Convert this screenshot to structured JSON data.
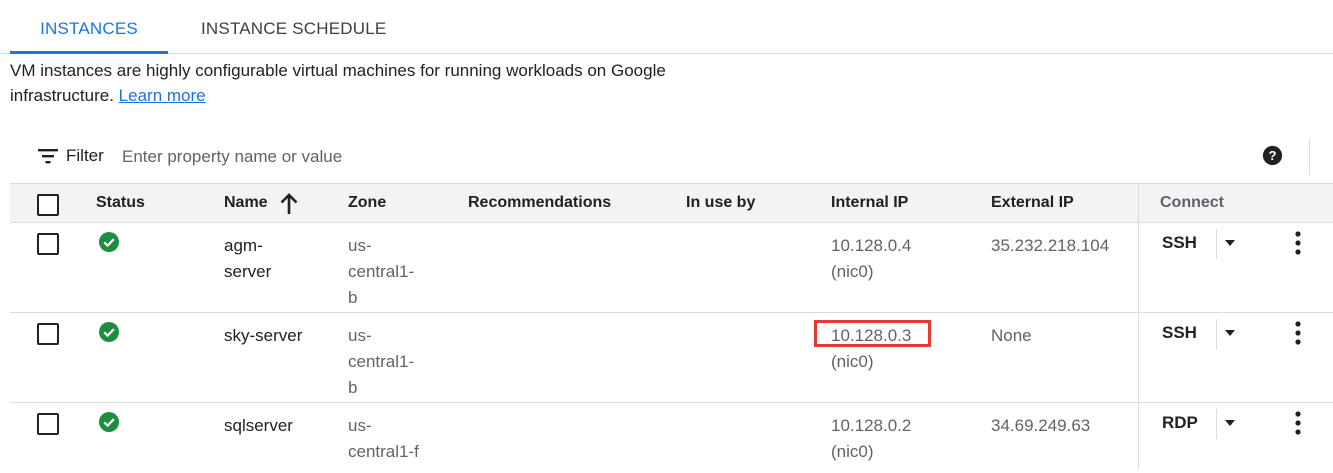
{
  "tabs": [
    {
      "label": "INSTANCES",
      "active": true
    },
    {
      "label": "INSTANCE SCHEDULE",
      "active": false
    }
  ],
  "description": {
    "text": "VM instances are highly configurable virtual machines for running workloads on Google infrastructure.",
    "link": "Learn more"
  },
  "filter": {
    "label": "Filter",
    "placeholder": "Enter property name or value",
    "icon": "filter-list-icon",
    "help_icon": "help-icon"
  },
  "columns": {
    "status": "Status",
    "name": "Name",
    "zone": "Zone",
    "recommendations": "Recommendations",
    "in_use_by": "In use by",
    "internal_ip": "Internal IP",
    "external_ip": "External IP",
    "connect": "Connect"
  },
  "rows": [
    {
      "status": "running",
      "name_l1": "agm-",
      "name_l2": "server",
      "zone_l1": "us-",
      "zone_l2": "central1-",
      "zone_l3": "b",
      "internal_ip": "10.128.0.4",
      "nic": "(nic0)",
      "external_ip": "35.232.218.104",
      "connect": "SSH"
    },
    {
      "status": "running",
      "name_l1": "sky-server",
      "zone_l1": "us-",
      "zone_l2": "central1-",
      "zone_l3": "b",
      "internal_ip": "10.128.0.3",
      "nic": "(nic0)",
      "external_ip": "None",
      "connect": "SSH"
    },
    {
      "status": "running",
      "name_l1": "sqlserver",
      "zone_l1": "us-",
      "zone_l2": "central1-f",
      "internal_ip": "10.128.0.2",
      "nic": "(nic0)",
      "external_ip": "34.69.249.63",
      "connect": "RDP"
    }
  ],
  "colors": {
    "accent": "#1a73e8",
    "status_ok": "#1e8e3e",
    "highlight": "#e53935"
  }
}
